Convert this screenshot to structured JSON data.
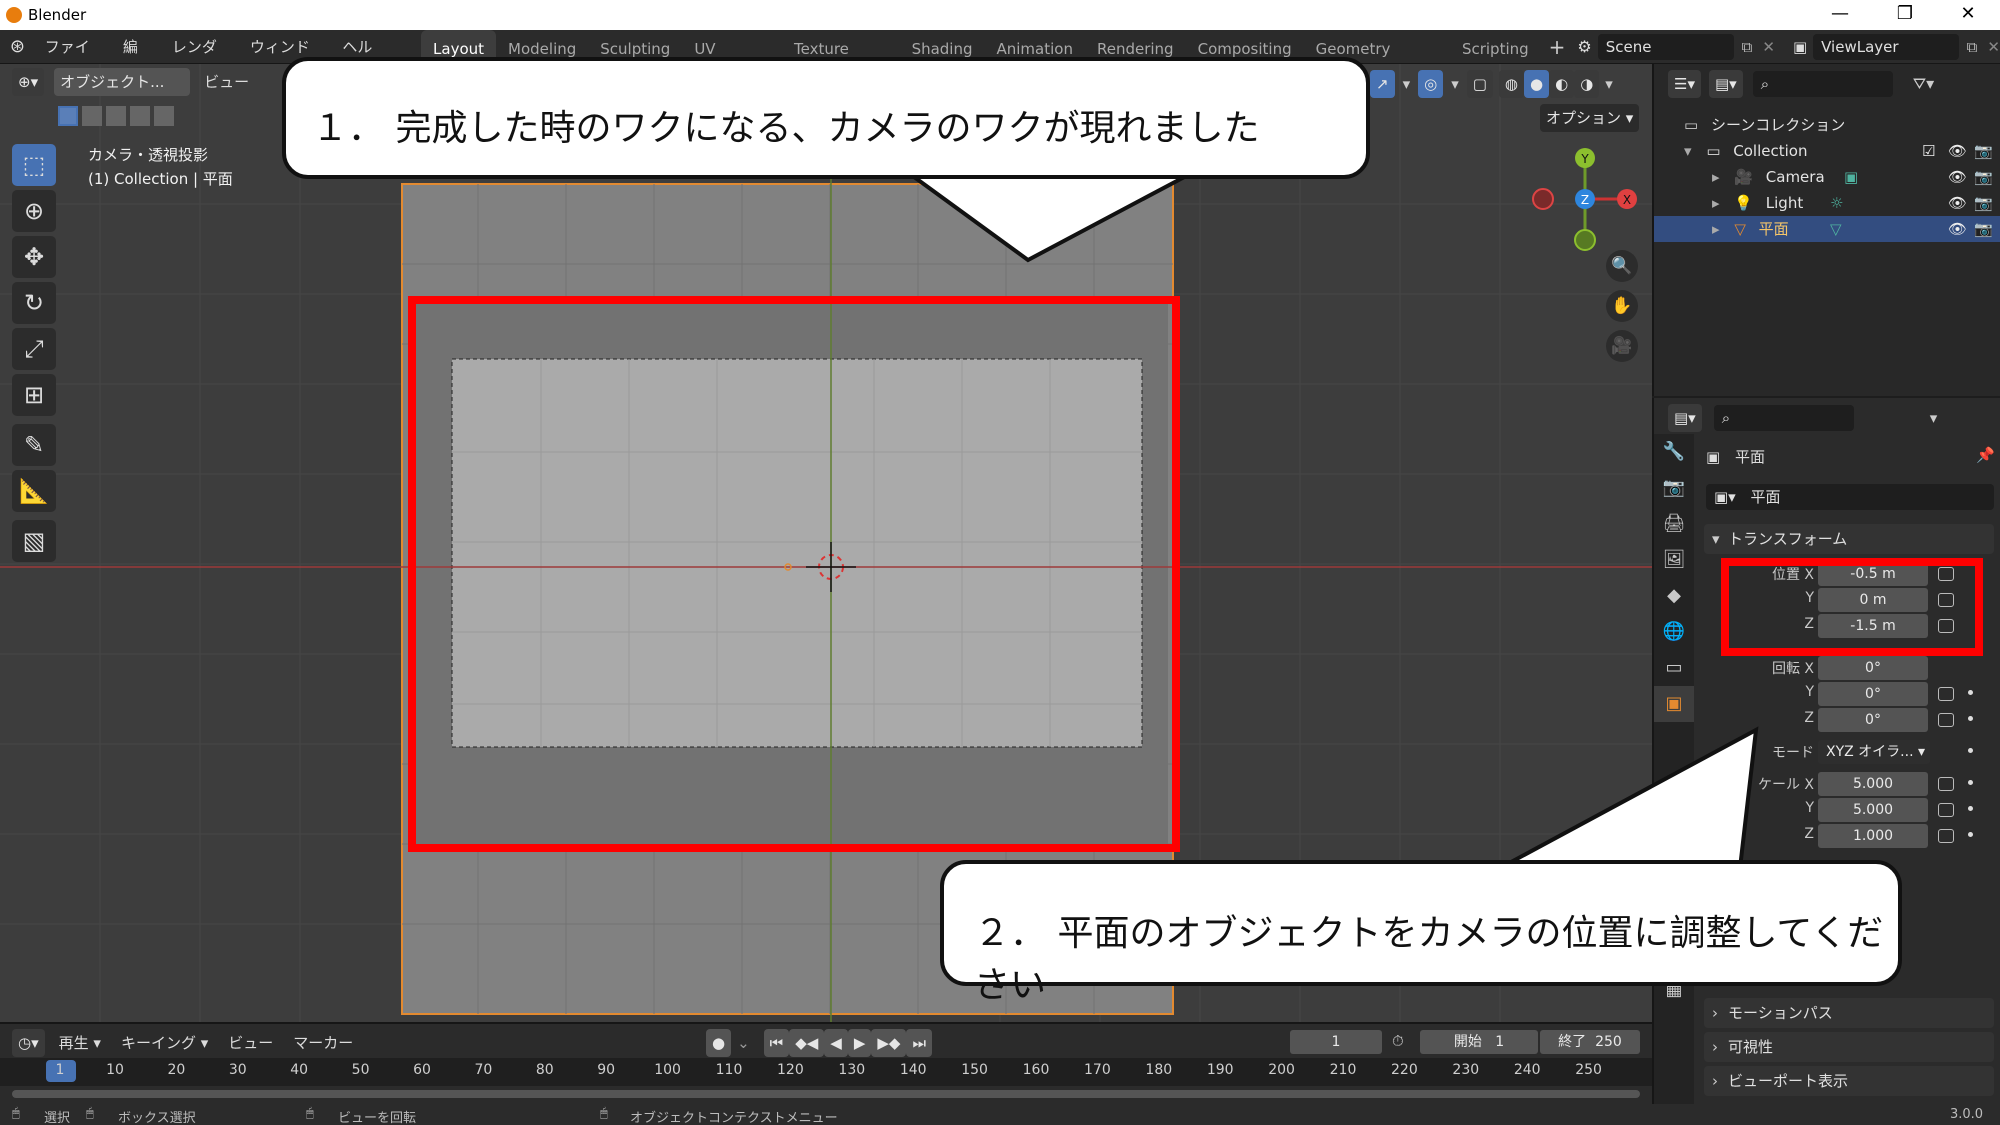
{
  "window": {
    "title": "Blender",
    "min": "—",
    "max": "❐",
    "close": "✕"
  },
  "menu": [
    "ファイル",
    "編集",
    "レンダー",
    "ウィンドウ",
    "ヘルプ"
  ],
  "workspaces": [
    "Layout",
    "Modeling",
    "Sculpting",
    "UV Editing",
    "Texture Paint",
    "Shading",
    "Animation",
    "Rendering",
    "Compositing",
    "Geometry Nodes",
    "Scripting"
  ],
  "topbar": {
    "add_tab": "+",
    "scene": "Scene",
    "view_layer": "ViewLayer"
  },
  "viewport": {
    "mode": "オブジェクト...",
    "view_menu": "ビュー",
    "options": "オプション",
    "info_line1": "カメラ・透視投影",
    "info_line2": "(1) Collection | 平面",
    "gizmo": {
      "x": "X",
      "y": "Y",
      "z": "Z"
    }
  },
  "outliner": {
    "root": "シーンコレクション",
    "items": [
      {
        "name": "Collection"
      },
      {
        "name": "Camera"
      },
      {
        "name": "Light"
      },
      {
        "name": "平面"
      }
    ]
  },
  "properties": {
    "object_name": "平面",
    "data_name": "平面",
    "transform_label": "トランスフォーム",
    "location": {
      "label": "位置 X",
      "x": "-0.5 m",
      "y": "0 m",
      "z": "-1.5 m"
    },
    "rotation": {
      "label": "回転 X",
      "x": "0°",
      "y": "0°",
      "z": "0°"
    },
    "mode": {
      "label": "モード",
      "value": "XYZ オイラ..."
    },
    "scale": {
      "label": "ケール X",
      "x": "5.000",
      "y": "5.000",
      "z": "1.000"
    },
    "axis_y": "Y",
    "axis_z": "Z",
    "panels": [
      "モーションパス",
      "可視性",
      "ビューポート表示"
    ]
  },
  "timeline": {
    "play": "再生",
    "keying": "キーイング",
    "view": "ビュー",
    "marker": "マーカー",
    "current_frame": "1",
    "start_label": "開始",
    "start": "1",
    "end_label": "終了",
    "end": "250",
    "ticks": [
      "1",
      "10",
      "20",
      "30",
      "40",
      "50",
      "60",
      "70",
      "80",
      "90",
      "100",
      "110",
      "120",
      "130",
      "140",
      "150",
      "160",
      "170",
      "180",
      "190",
      "200",
      "210",
      "220",
      "230",
      "240",
      "250"
    ]
  },
  "statusbar": {
    "select": "選択",
    "box_select": "ボックス選択",
    "rotate_view": "ビューを回転",
    "context_menu": "オブジェクトコンテクストメニュー",
    "version": "3.0.0"
  },
  "callouts": {
    "one": "１． 完成した時のワクになる、カメラのワクが現れました",
    "two": "２． 平面のオブジェクトをカメラの位置に調整してください"
  },
  "colors": {
    "highlight": "#ff0000",
    "selection": "#334d80",
    "accent_orange": "#e38a30",
    "active_blue": "#4772b3"
  }
}
